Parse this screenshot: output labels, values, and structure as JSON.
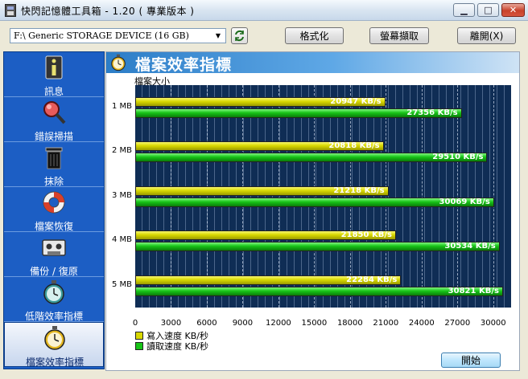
{
  "window": {
    "title": "快閃記憶體工具箱 - 1.20 ( 專業版本 )"
  },
  "toolbar": {
    "device": "F:\\ Generic STORAGE DEVICE (16 GB)",
    "format_label": "格式化",
    "screenshot_label": "螢幕擷取",
    "exit_label": "離開(X)"
  },
  "sidebar": {
    "items": [
      {
        "label": "訊息",
        "icon": "info-icon"
      },
      {
        "label": "錯誤掃描",
        "icon": "magnifier-icon"
      },
      {
        "label": "抹除",
        "icon": "trash-can-icon"
      },
      {
        "label": "檔案恢復",
        "icon": "lifebuoy-icon"
      },
      {
        "label": "備份 / 復原",
        "icon": "tape-cassette-icon"
      },
      {
        "label": "低階效率指標",
        "icon": "stopwatch-icon"
      },
      {
        "label": "檔案效率指標",
        "icon": "stopwatch-icon",
        "active": true
      }
    ]
  },
  "main": {
    "header_title": "檔案效率指標",
    "start_label": "開始"
  },
  "chart_data": {
    "type": "bar",
    "orientation": "horizontal",
    "ylabel": "檔案大小",
    "categories": [
      "1 MB",
      "2 MB",
      "3 MB",
      "4 MB",
      "5 MB"
    ],
    "series": [
      {
        "name": "寫入速度 KB/秒",
        "values": [
          20947,
          20818,
          21218,
          21850,
          22284
        ],
        "color": "#d8d800",
        "labels": [
          "20947 KB/s",
          "20818 KB/s",
          "21218 KB/s",
          "21850 KB/s",
          "22284 KB/s"
        ]
      },
      {
        "name": "讀取速度 KB/秒",
        "values": [
          27356,
          29510,
          30069,
          30534,
          30821
        ],
        "color": "#17c417",
        "labels": [
          "27356 KB/s",
          "29510 KB/s",
          "30069 KB/s",
          "30534 KB/s",
          "30821 KB/s"
        ]
      }
    ],
    "xlim": [
      0,
      31500
    ],
    "xticks": [
      "0",
      "3000",
      "6000",
      "9000",
      "12000",
      "15000",
      "18000",
      "21000",
      "24000",
      "27000",
      "30000"
    ],
    "grid": true,
    "legend_position": "bottom-left"
  }
}
